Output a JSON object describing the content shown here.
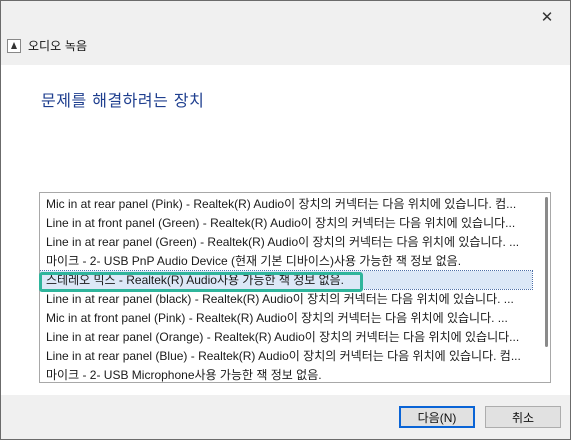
{
  "window": {
    "title": "오디오 녹음",
    "close_glyph": "✕"
  },
  "page": {
    "heading": "문제를 해결하려는 장치"
  },
  "devices": [
    "Mic in at rear panel (Pink) - Realtek(R) Audio이 장치의 커넥터는 다음 위치에 있습니다. 컴...",
    "Line in at front panel (Green) - Realtek(R) Audio이 장치의 커넥터는 다음 위치에 있습니다...",
    "Line in at rear panel (Green) - Realtek(R) Audio이 장치의 커넥터는 다음 위치에 있습니다. ...",
    "마이크 - 2- USB PnP Audio Device (현재 기본 디바이스)사용 가능한 잭 정보 없음.",
    "스테레오 믹스 - Realtek(R) Audio사용 가능한 잭 정보 없음.",
    "Line in at rear panel (black) - Realtek(R) Audio이 장치의 커넥터는 다음 위치에 있습니다. ...",
    "Mic in at front panel (Pink) - Realtek(R) Audio이 장치의 커넥터는 다음 위치에 있습니다. ...",
    "Line in at rear panel (Orange) - Realtek(R) Audio이 장치의 커넥터는 다음 위치에 있습니다...",
    "Line in at rear panel (Blue) - Realtek(R) Audio이 장치의 커넥터는 다음 위치에 있습니다. 컴...",
    "마이크 - 2- USB Microphone사용 가능한 잭 정보 없음."
  ],
  "selected_index": 4,
  "footer": {
    "next_label": "다음(N)",
    "cancel_label": "취소"
  },
  "colors": {
    "heading": "#1f3f8f",
    "highlight": "#2fb59c",
    "selected_bg": "#dce8f7"
  }
}
